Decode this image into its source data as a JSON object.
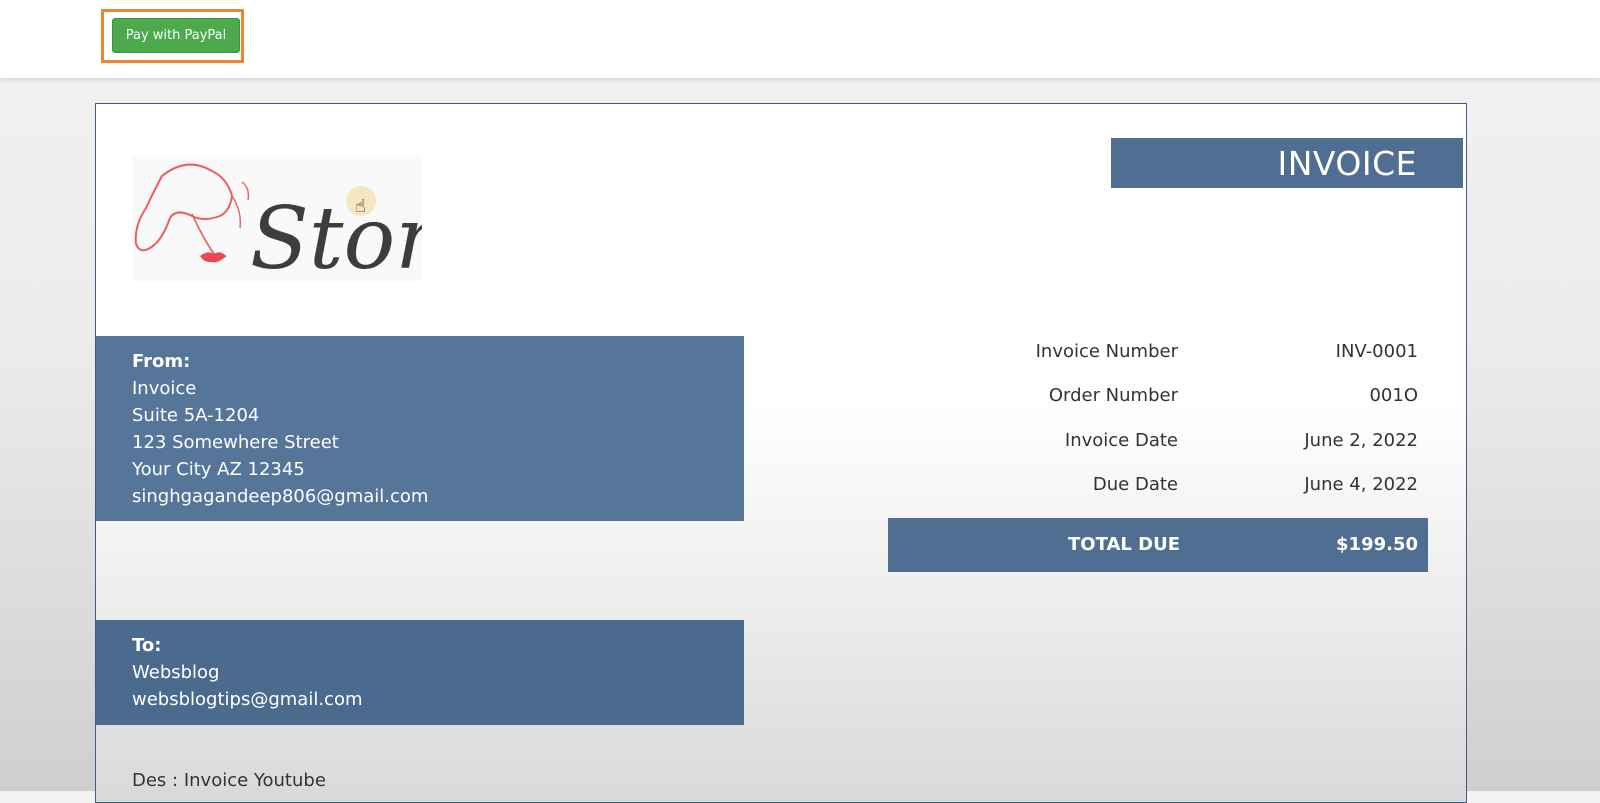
{
  "toolbar": {
    "paypal_label": "Pay with PayPal",
    "accent": "#4caa4c",
    "highlight": "#f0832b"
  },
  "logo": {
    "text": "Store",
    "icon": "woman-face-logo-icon"
  },
  "invoice": {
    "title": "INVOICE",
    "from": {
      "label": "From:",
      "name": "Invoice",
      "suite": "Suite 5A-1204",
      "street": "123 Somewhere Street",
      "city": "Your City AZ 12345",
      "email": "singhgagandeep806@gmail.com"
    },
    "to": {
      "label": "To:",
      "name": "Websblog",
      "email": "websblogtips@gmail.com"
    },
    "details": [
      {
        "label": "Invoice Number",
        "value": "INV-0001"
      },
      {
        "label": "Order Number",
        "value": "001O"
      },
      {
        "label": "Invoice Date",
        "value": "June 2, 2022"
      },
      {
        "label": "Due Date",
        "value": "June 4, 2022"
      }
    ],
    "total": {
      "label": "TOTAL DUE",
      "value": "$199.50"
    },
    "description": "Des : Invoice Youtube",
    "colors": {
      "header": "#4f6e92",
      "border": "#3b5e87"
    }
  }
}
